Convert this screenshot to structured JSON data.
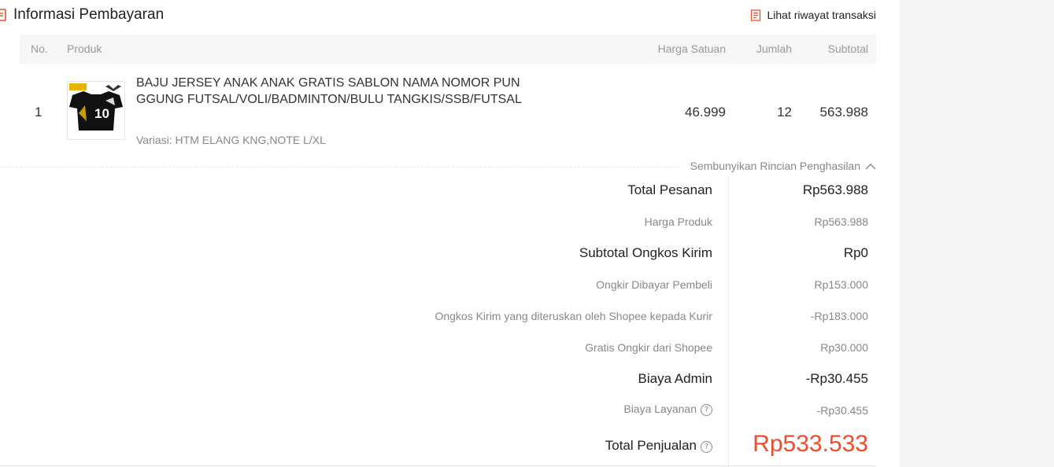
{
  "header": {
    "title": "Informasi Pembayaran",
    "history_link": "Lihat riwayat transaksi"
  },
  "table": {
    "columns": {
      "no": "No.",
      "product": "Produk",
      "unit_price": "Harga Satuan",
      "quantity": "Jumlah",
      "subtotal": "Subtotal"
    },
    "rows": [
      {
        "no": "1",
        "name": "BAJU JERSEY ANAK ANAK GRATIS SABLON NAMA NOMOR PUNGGUNG FUTSAL/VOLI/BADMINTON/BULU TANGKIS/SSB/FUTSAL",
        "variation": "Variasi: HTM ELANG KNG,NOTE L/XL",
        "unit_price": "46.999",
        "quantity": "12",
        "subtotal": "563.988",
        "thumb_jersey_number": "10"
      }
    ]
  },
  "details_toggle": "Sembunyikan Rincian Penghasilan",
  "summary": {
    "total_pesanan": {
      "label": "Total Pesanan",
      "value": "Rp563.988"
    },
    "harga_produk": {
      "label": "Harga Produk",
      "value": "Rp563.988"
    },
    "subtotal_ongkir": {
      "label": "Subtotal Ongkos Kirim",
      "value": "Rp0"
    },
    "ongkir_pembeli": {
      "label": "Ongkir Dibayar Pembeli",
      "value": "Rp153.000"
    },
    "ongkir_diteruskan": {
      "label": "Ongkos Kirim yang diteruskan oleh Shopee kepada Kurir",
      "value": "-Rp183.000"
    },
    "gratis_ongkir": {
      "label": "Gratis Ongkir dari Shopee",
      "value": "Rp30.000"
    },
    "biaya_admin": {
      "label": "Biaya Admin",
      "value": "-Rp30.455"
    },
    "biaya_layanan": {
      "label": "Biaya Layanan",
      "value": "-Rp30.455"
    },
    "total_penjualan": {
      "label": "Total Penjualan",
      "value": "Rp533.533"
    }
  },
  "help_icon_glyph": "?",
  "colors": {
    "accent": "#ee4d2d",
    "header_bg": "#f6f6f6",
    "muted_text": "#888888"
  }
}
